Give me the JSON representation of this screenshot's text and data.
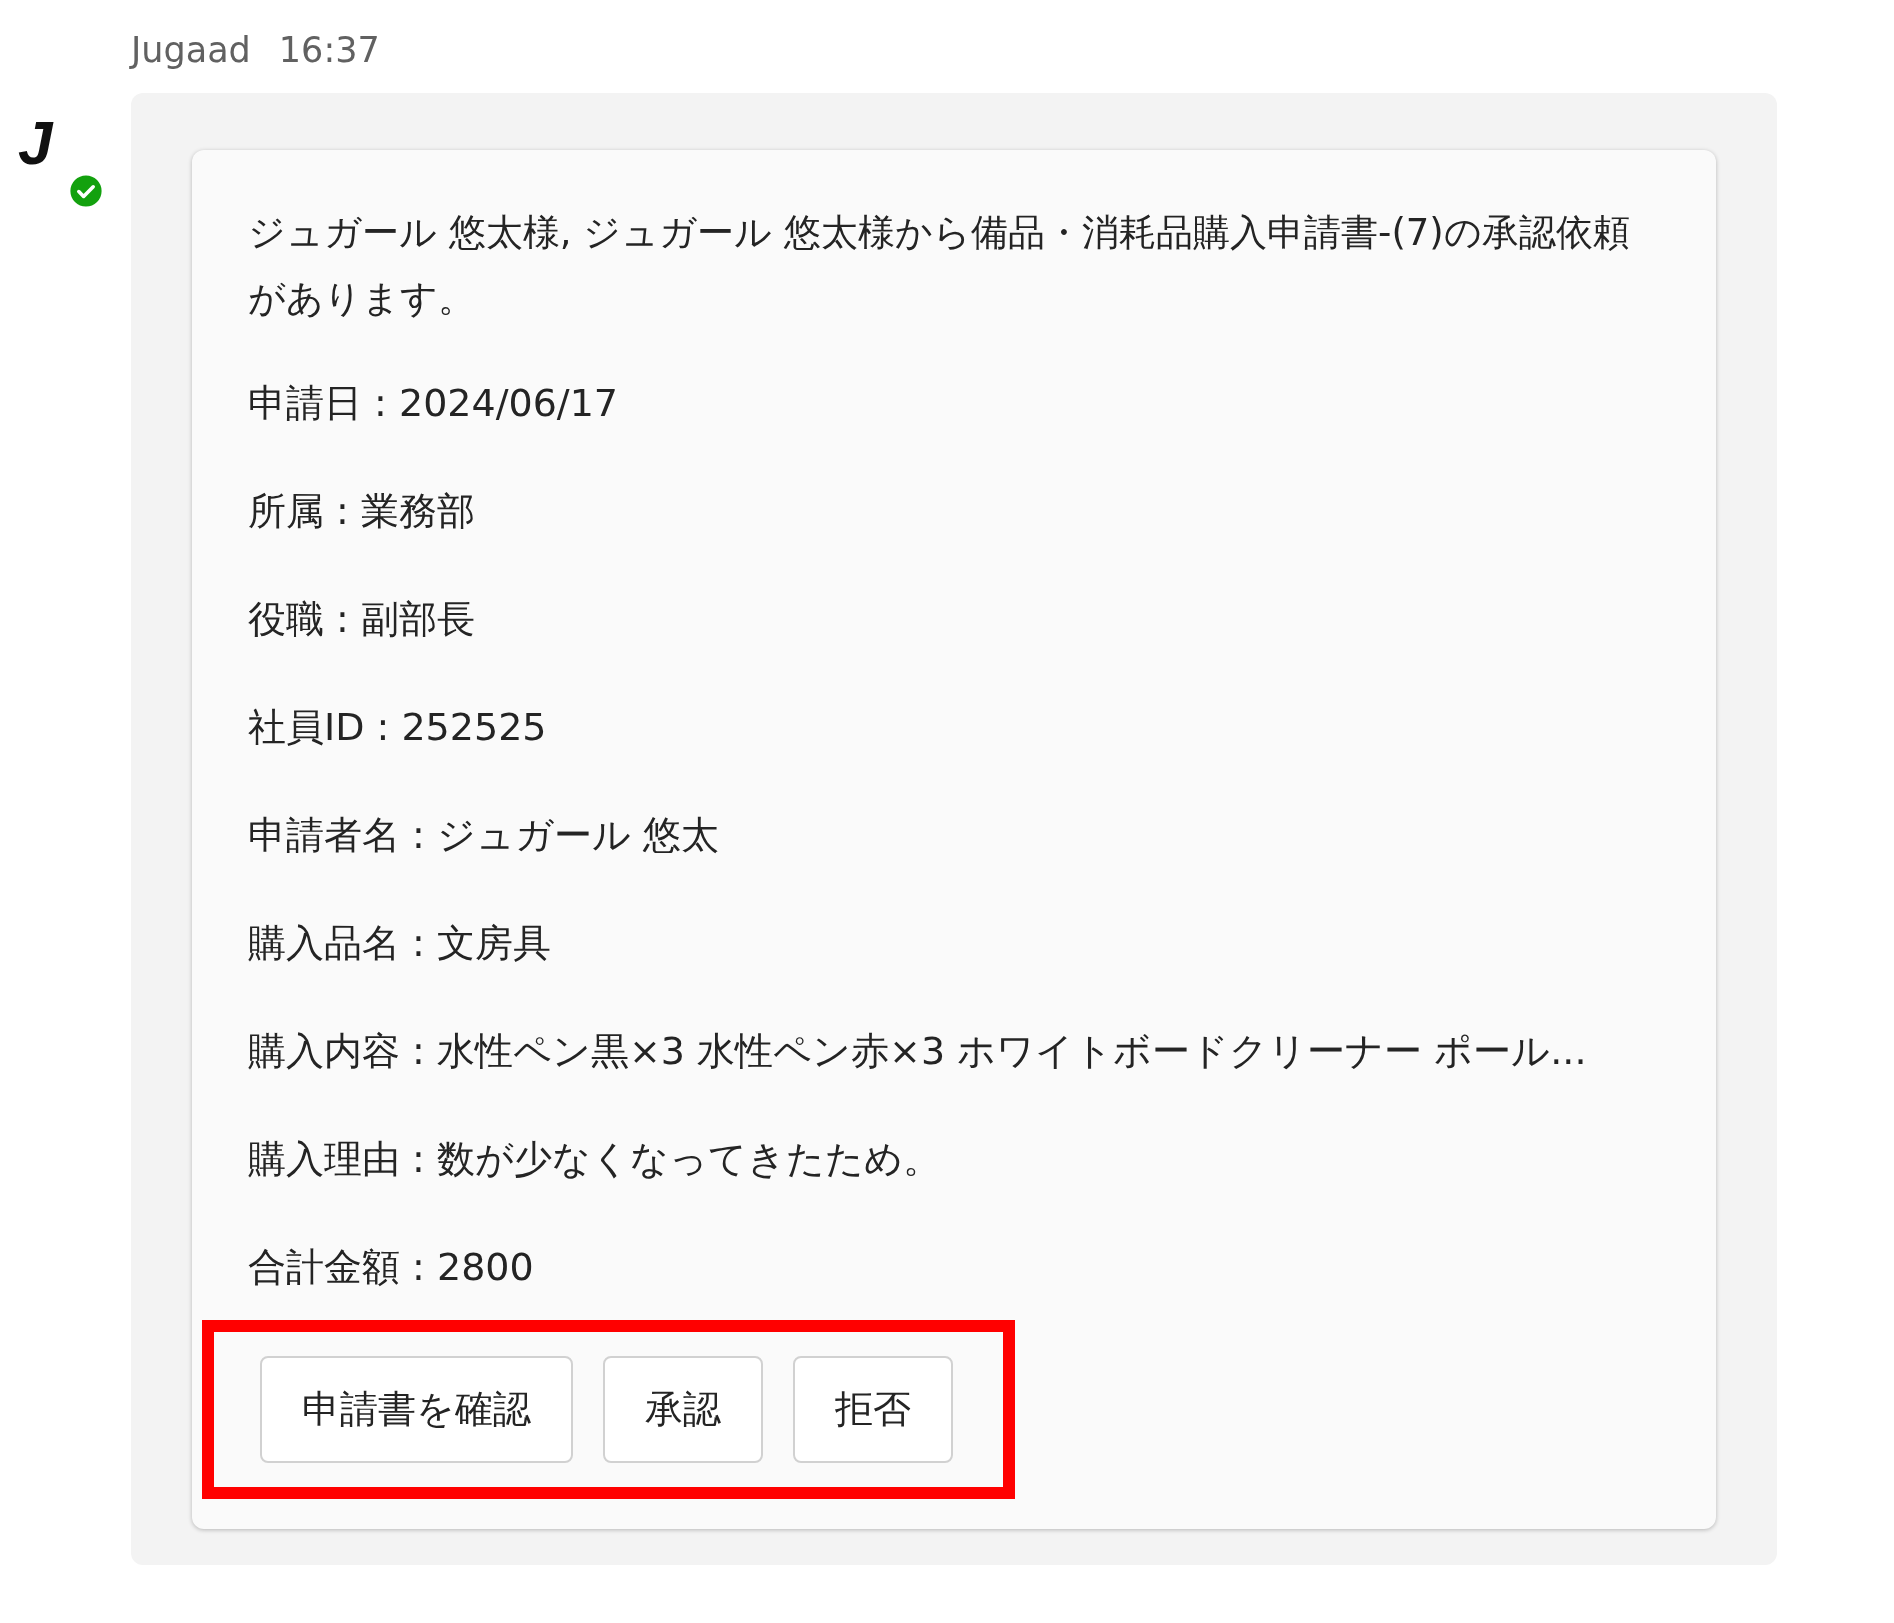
{
  "message": {
    "sender": "Jugaad",
    "time": "16:37",
    "avatar": {
      "initial": "J",
      "online": true
    }
  },
  "card": {
    "intro": "ジュガール 悠太様, ジュガール 悠太様から備品・消耗品購入申請書-(7)の承認依頼があります。",
    "fields": [
      "申請日 : 2024/06/17",
      "所属 : 業務部",
      "役職 : 副部長",
      "社員ID : 252525",
      "申請者名 : ジュガール 悠太",
      "購入品名 : 文房具",
      "購入内容 : 水性ペン黒×3 水性ペン赤×3 ホワイトボードクリーナー ポール...",
      "購入理由 : 数が少なくなってきたため。",
      "合計金額 : 2800"
    ],
    "actions_highlighted": true,
    "actions": [
      {
        "label": "申請書を確認"
      },
      {
        "label": "承認"
      },
      {
        "label": "拒否"
      }
    ]
  }
}
